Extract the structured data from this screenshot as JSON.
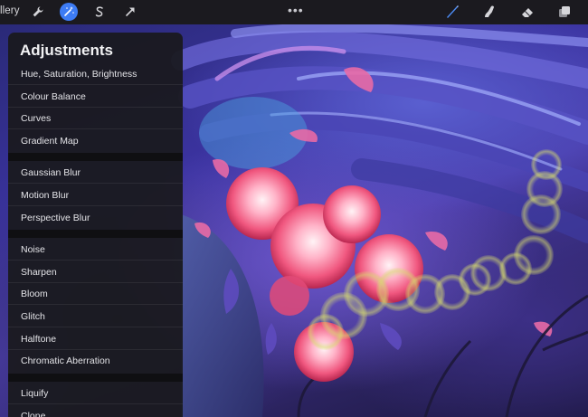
{
  "toolbar": {
    "gallery_label": "llery",
    "left_tools": [
      {
        "icon": "wrench-icon",
        "name": "actions-button"
      },
      {
        "icon": "magic-wand-icon",
        "name": "adjustments-button",
        "active": true
      },
      {
        "icon": "selection-s-icon",
        "name": "selection-button"
      },
      {
        "icon": "arrow-cursor-icon",
        "name": "transform-button"
      }
    ],
    "more_label": "•••",
    "right_tools": [
      {
        "icon": "brush-icon",
        "name": "paint-tool-button",
        "active": true
      },
      {
        "icon": "smudge-icon",
        "name": "smudge-tool-button"
      },
      {
        "icon": "eraser-icon",
        "name": "eraser-tool-button"
      },
      {
        "icon": "layers-icon",
        "name": "layers-button"
      }
    ],
    "accent_color": "#3d7cf5"
  },
  "adjustments": {
    "title": "Adjustments",
    "groups": [
      [
        "Hue, Saturation, Brightness",
        "Colour Balance",
        "Curves",
        "Gradient Map"
      ],
      [
        "Gaussian Blur",
        "Motion Blur",
        "Perspective Blur"
      ],
      [
        "Noise",
        "Sharpen",
        "Bloom",
        "Glitch",
        "Halftone",
        "Chromatic Aberration"
      ],
      [
        "Liquify",
        "Clone"
      ]
    ]
  }
}
